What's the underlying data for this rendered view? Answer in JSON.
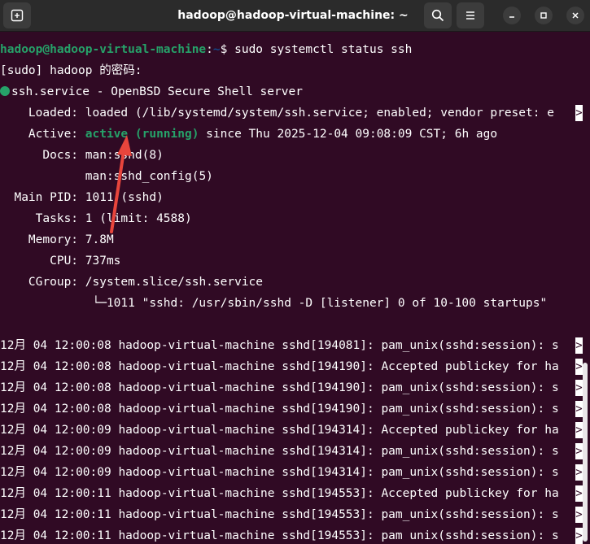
{
  "window": {
    "title": "hadoop@hadoop-virtual-machine: ~",
    "new_tab_icon": "new-tab-icon",
    "search_icon": "search-icon",
    "menu_icon": "hamburger-menu-icon",
    "minimize_icon": "minimize-icon",
    "maximize_icon": "maximize-icon",
    "close_icon": "close-icon"
  },
  "terminal": {
    "prompt_user": "hadoop@hadoop-virtual-machine",
    "prompt_sep": ":",
    "prompt_path": "~",
    "prompt_dollar": "$ ",
    "command": "sudo systemctl status ssh",
    "sudo_prompt": "[sudo] hadoop 的密码:",
    "service_header": "ssh.service - OpenBSD Secure Shell server",
    "loaded_label": "    Loaded: ",
    "loaded_value": "loaded (/lib/systemd/system/ssh.service; enabled; vendor preset: e",
    "active_label": "    Active: ",
    "active_state": "active (running)",
    "active_rest": " since Thu 2025-12-04 09:08:09 CST; 6h ago",
    "docs_label": "      Docs: ",
    "docs_value1": "man:sshd(8)",
    "docs_value2": "man:sshd_config(5)",
    "mainpid_label": "  Main PID: ",
    "mainpid_value": "1011 (sshd)",
    "tasks_label": "     Tasks: ",
    "tasks_value": "1 (limit: 4588)",
    "memory_label": "    Memory: ",
    "memory_value": "7.8M",
    "cpu_label": "       CPU: ",
    "cpu_value": "737ms",
    "cgroup_label": "    CGroup: ",
    "cgroup_value": "/system.slice/ssh.service",
    "cgroup_tree": "             └─1011 \"sshd: /usr/sbin/sshd -D [listener] 0 of 10-100 startups\"",
    "log_lines": [
      "12月 04 12:00:08 hadoop-virtual-machine sshd[194081]: pam_unix(sshd:session): s",
      "12月 04 12:00:08 hadoop-virtual-machine sshd[194190]: Accepted publickey for ha",
      "12月 04 12:00:08 hadoop-virtual-machine sshd[194190]: pam_unix(sshd:session): s",
      "12月 04 12:00:08 hadoop-virtual-machine sshd[194190]: pam_unix(sshd:session): s",
      "12月 04 12:00:09 hadoop-virtual-machine sshd[194314]: Accepted publickey for ha",
      "12月 04 12:00:09 hadoop-virtual-machine sshd[194314]: pam_unix(sshd:session): s",
      "12月 04 12:00:09 hadoop-virtual-machine sshd[194314]: pam_unix(sshd:session): s",
      "12月 04 12:00:11 hadoop-virtual-machine sshd[194553]: Accepted publickey for ha",
      "12月 04 12:00:11 hadoop-virtual-machine sshd[194553]: pam_unix(sshd:session): s",
      "12月 04 12:00:11 hadoop-virtual-machine sshd[194553]: pam_unix(sshd:session): s"
    ],
    "truncation_marker": ">"
  },
  "colors": {
    "terminal_bg": "#300a24",
    "titlebar_bg": "#2b2b2b",
    "active_green": "#26a269",
    "prompt_blue": "#12488b",
    "annotation_arrow": "#e8453c"
  }
}
